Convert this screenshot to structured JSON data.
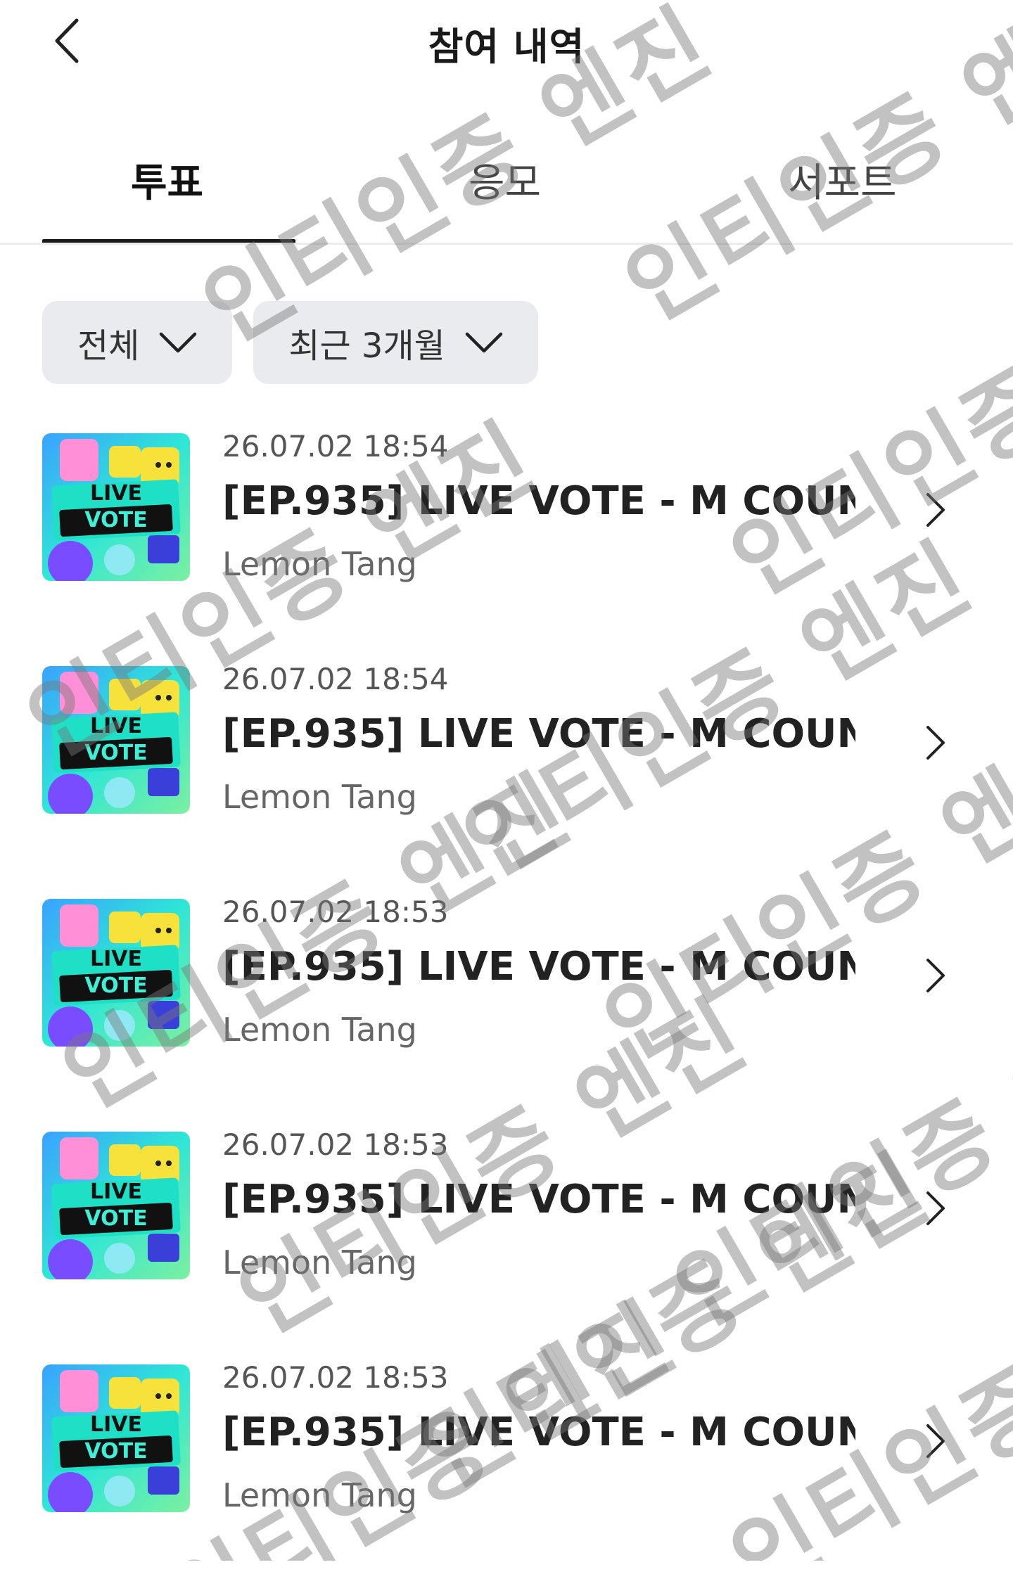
{
  "header": {
    "title": "참여 내역",
    "back_icon": "chevron-left-icon"
  },
  "tabs": [
    {
      "label": "투표",
      "active": true
    },
    {
      "label": "응모",
      "active": false
    },
    {
      "label": "서포트",
      "active": false
    }
  ],
  "filters": {
    "category": {
      "label": "전체",
      "icon": "chevron-down-icon"
    },
    "period": {
      "label": "최근 3개월",
      "icon": "chevron-down-icon"
    }
  },
  "items": [
    {
      "date": "26.07.02 18:54",
      "title": "[EP.935] LIVE VOTE - M COUN...",
      "subtitle": "Lemon Tang",
      "thumb_text": [
        "LIVE",
        "VOTE"
      ]
    },
    {
      "date": "26.07.02 18:54",
      "title": "[EP.935] LIVE VOTE - M COUN...",
      "subtitle": "Lemon Tang",
      "thumb_text": [
        "LIVE",
        "VOTE"
      ]
    },
    {
      "date": "26.07.02 18:53",
      "title": "[EP.935] LIVE VOTE - M COUN...",
      "subtitle": "Lemon Tang",
      "thumb_text": [
        "LIVE",
        "VOTE"
      ]
    },
    {
      "date": "26.07.02 18:53",
      "title": "[EP.935] LIVE VOTE - M COUN...",
      "subtitle": "Lemon Tang",
      "thumb_text": [
        "LIVE",
        "VOTE"
      ]
    },
    {
      "date": "26.07.02 18:53",
      "title": "[EP.935] LIVE VOTE - M COUN...",
      "subtitle": "Lemon Tang",
      "thumb_text": [
        "LIVE",
        "VOTE"
      ]
    }
  ],
  "watermark": {
    "text": "인티인증 엔진"
  },
  "colors": {
    "accent": "#1a1a1a",
    "filter_bg": "#eaebef",
    "thumb_bg": "#2ee6d6",
    "thumb_band": "#111111"
  }
}
